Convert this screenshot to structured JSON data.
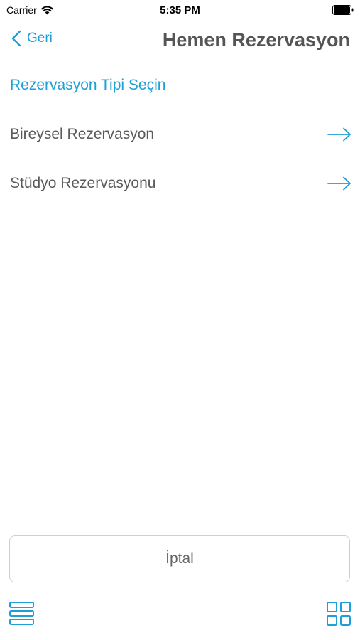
{
  "status_bar": {
    "carrier": "Carrier",
    "time": "5:35 PM",
    "icons": [
      "wifi-icon",
      "battery-icon"
    ]
  },
  "nav": {
    "back_label": "Geri",
    "back_icon": "chevron-left-icon",
    "title": "Hemen Rezervasyon"
  },
  "section": {
    "title": "Rezervasyon Tipi Seçin"
  },
  "list": {
    "items": [
      {
        "label": "Bireysel Rezervasyon",
        "icon": "arrow-right-icon"
      },
      {
        "label": "Stüdyo Rezervasyonu",
        "icon": "arrow-right-icon"
      }
    ]
  },
  "footer": {
    "cancel_label": "İptal",
    "left_icon": "menu-list-icon",
    "right_icon": "grid-icon"
  },
  "colors": {
    "accent": "#1e9fd6",
    "text": "#555555",
    "divider": "#dcdcdc"
  }
}
